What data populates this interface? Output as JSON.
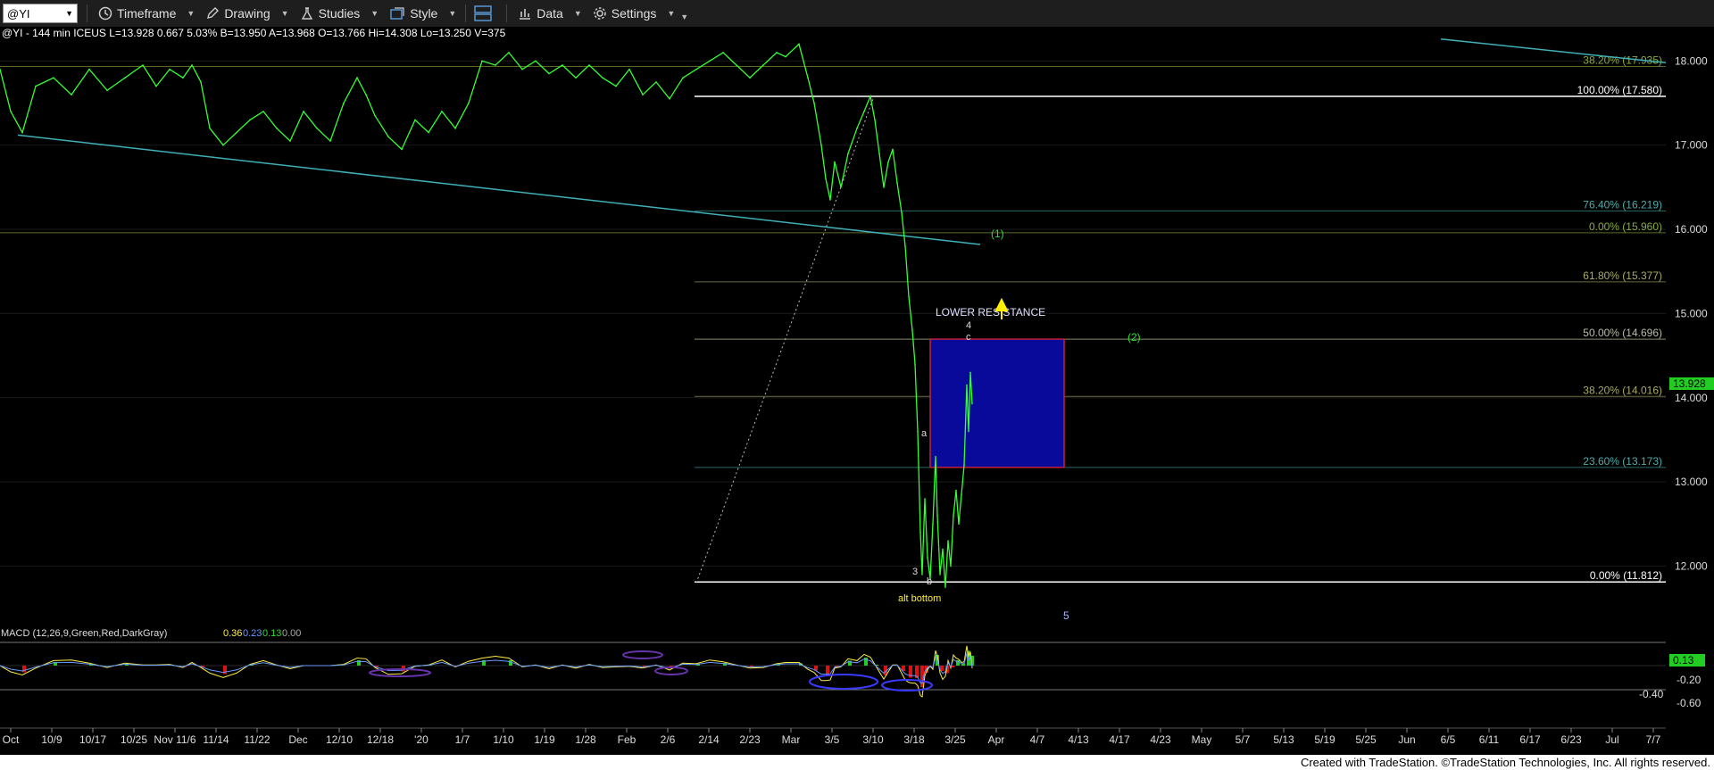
{
  "toolbar": {
    "symbol": "@YI",
    "timeframe": "Timeframe",
    "drawing": "Drawing",
    "studies": "Studies",
    "style": "Style",
    "data": "Data",
    "settings": "Settings"
  },
  "chart_data": {
    "type": "line",
    "header_text": "@YI - 144 min  ICEUS  L=13.928  0.667  5.03%  B=13.950  A=13.968  O=13.766  Hi=14.308  Lo=13.250  V=375",
    "last_price": "13.928",
    "colors": {
      "price": "#33ff33",
      "background": "#000000",
      "trendline": "#40b0b8",
      "box": "#0a0a9a",
      "box_border": "#c02040"
    },
    "y_axis": {
      "ylim": [
        11.2,
        18.3
      ],
      "ticks": [
        "18.000",
        "17.000",
        "16.000",
        "15.000",
        "14.000",
        "13.000",
        "12.000"
      ]
    },
    "x_axis": {
      "ticks": [
        "Oct",
        "10/9",
        "10/17",
        "10/25",
        "Nov 11/6",
        "11/14",
        "11/22",
        "Dec",
        "12/10",
        "12/18",
        "'20",
        "1/7",
        "1/10",
        "1/19",
        "1/28",
        "Feb",
        "2/6",
        "2/14",
        "2/23",
        "Mar",
        "3/5",
        "3/10",
        "3/18",
        "3/25",
        "Apr",
        "4/7",
        "4/13",
        "4/17",
        "4/23",
        "May",
        "5/7",
        "5/13",
        "5/19",
        "5/25",
        "Jun",
        "6/5",
        "6/11",
        "6/17",
        "6/23",
        "Jul",
        "7/7"
      ]
    },
    "fib_levels": [
      {
        "label": "38.20% (17.935)",
        "value": 17.935
      },
      {
        "label": "100.00% (17.580)",
        "value": 17.58
      },
      {
        "label": "76.40% (16.219)",
        "value": 16.219
      },
      {
        "label": "0.00% (15.960)",
        "value": 15.96
      },
      {
        "label": "61.80% (15.377)",
        "value": 15.377
      },
      {
        "label": "50.00% (14.696)",
        "value": 14.696
      },
      {
        "label": "38.20% (14.016)",
        "value": 14.016
      },
      {
        "label": "23.60% (13.173)",
        "value": 13.173
      },
      {
        "label": "0.00% (11.812)",
        "value": 11.812
      }
    ],
    "series": [
      {
        "name": "@YI",
        "points": [
          [
            0,
            17.9
          ],
          [
            12,
            17.4
          ],
          [
            25,
            17.15
          ],
          [
            40,
            17.7
          ],
          [
            60,
            17.8
          ],
          [
            80,
            17.6
          ],
          [
            100,
            17.9
          ],
          [
            120,
            17.65
          ],
          [
            140,
            17.8
          ],
          [
            160,
            17.95
          ],
          [
            175,
            17.7
          ],
          [
            190,
            17.9
          ],
          [
            205,
            17.8
          ],
          [
            215,
            17.95
          ],
          [
            225,
            17.75
          ],
          [
            235,
            17.2
          ],
          [
            250,
            17.0
          ],
          [
            265,
            17.15
          ],
          [
            280,
            17.3
          ],
          [
            295,
            17.4
          ],
          [
            310,
            17.2
          ],
          [
            325,
            17.05
          ],
          [
            340,
            17.4
          ],
          [
            355,
            17.2
          ],
          [
            370,
            17.05
          ],
          [
            385,
            17.5
          ],
          [
            400,
            17.8
          ],
          [
            410,
            17.6
          ],
          [
            420,
            17.35
          ],
          [
            435,
            17.1
          ],
          [
            450,
            16.95
          ],
          [
            465,
            17.3
          ],
          [
            480,
            17.15
          ],
          [
            495,
            17.4
          ],
          [
            510,
            17.2
          ],
          [
            525,
            17.5
          ],
          [
            540,
            18.0
          ],
          [
            555,
            17.95
          ],
          [
            570,
            18.1
          ],
          [
            585,
            17.9
          ],
          [
            600,
            18.0
          ],
          [
            615,
            17.85
          ],
          [
            630,
            17.95
          ],
          [
            645,
            17.8
          ],
          [
            660,
            17.95
          ],
          [
            675,
            17.8
          ],
          [
            690,
            17.7
          ],
          [
            705,
            17.9
          ],
          [
            720,
            17.6
          ],
          [
            735,
            17.75
          ],
          [
            750,
            17.55
          ],
          [
            765,
            17.8
          ],
          [
            780,
            17.9
          ],
          [
            795,
            18.0
          ],
          [
            810,
            18.1
          ],
          [
            825,
            17.95
          ],
          [
            840,
            17.8
          ],
          [
            855,
            17.95
          ],
          [
            870,
            18.1
          ],
          [
            880,
            18.05
          ],
          [
            895,
            18.2
          ],
          [
            905,
            17.8
          ],
          [
            912,
            17.5
          ],
          [
            920,
            17.0
          ],
          [
            925,
            16.6
          ],
          [
            930,
            16.35
          ],
          [
            935,
            16.8
          ],
          [
            942,
            16.5
          ],
          [
            950,
            16.9
          ],
          [
            960,
            17.2
          ],
          [
            968,
            17.4
          ],
          [
            975,
            17.58
          ],
          [
            980,
            17.3
          ],
          [
            985,
            16.9
          ],
          [
            990,
            16.5
          ],
          [
            995,
            16.8
          ],
          [
            1000,
            16.95
          ],
          [
            1005,
            16.55
          ],
          [
            1010,
            16.2
          ],
          [
            1014,
            15.8
          ],
          [
            1018,
            15.2
          ],
          [
            1022,
            14.8
          ],
          [
            1025,
            14.4
          ],
          [
            1028,
            13.6
          ],
          [
            1031,
            12.4
          ],
          [
            1033,
            11.9
          ],
          [
            1036,
            12.8
          ],
          [
            1039,
            12.1
          ],
          [
            1042,
            11.85
          ],
          [
            1045,
            12.5
          ],
          [
            1048,
            13.3
          ],
          [
            1050,
            12.6
          ],
          [
            1053,
            11.9
          ],
          [
            1056,
            12.2
          ],
          [
            1059,
            11.75
          ],
          [
            1062,
            12.3
          ],
          [
            1065,
            12.0
          ],
          [
            1068,
            12.6
          ],
          [
            1071,
            12.9
          ],
          [
            1074,
            12.5
          ],
          [
            1077,
            12.85
          ],
          [
            1080,
            13.2
          ],
          [
            1083,
            14.15
          ],
          [
            1085,
            13.6
          ],
          [
            1087,
            14.3
          ],
          [
            1089,
            13.93
          ]
        ]
      },
      {
        "name": "MACD (12,26,9,Green,Red,DarkGray)",
        "values": [
          "0.36",
          "0.23",
          "0.13",
          "0.00"
        ]
      }
    ],
    "macd_axis": {
      "ticks": [
        "-0.20",
        "-0.40",
        "-0.60"
      ],
      "last_value": "0.13"
    },
    "annotations": {
      "wave_1": "(1)",
      "wave_2": "(2)",
      "lower_resistance": "LOWER RESISTANCE",
      "w4": "4",
      "wc": "c",
      "wa": "a",
      "w3": "3",
      "wb": "b",
      "alt_bottom": "alt bottom",
      "w5": "5"
    }
  },
  "footer": {
    "text": "Created with TradeStation. ©TradeStation Technologies, Inc. All rights reserved."
  }
}
